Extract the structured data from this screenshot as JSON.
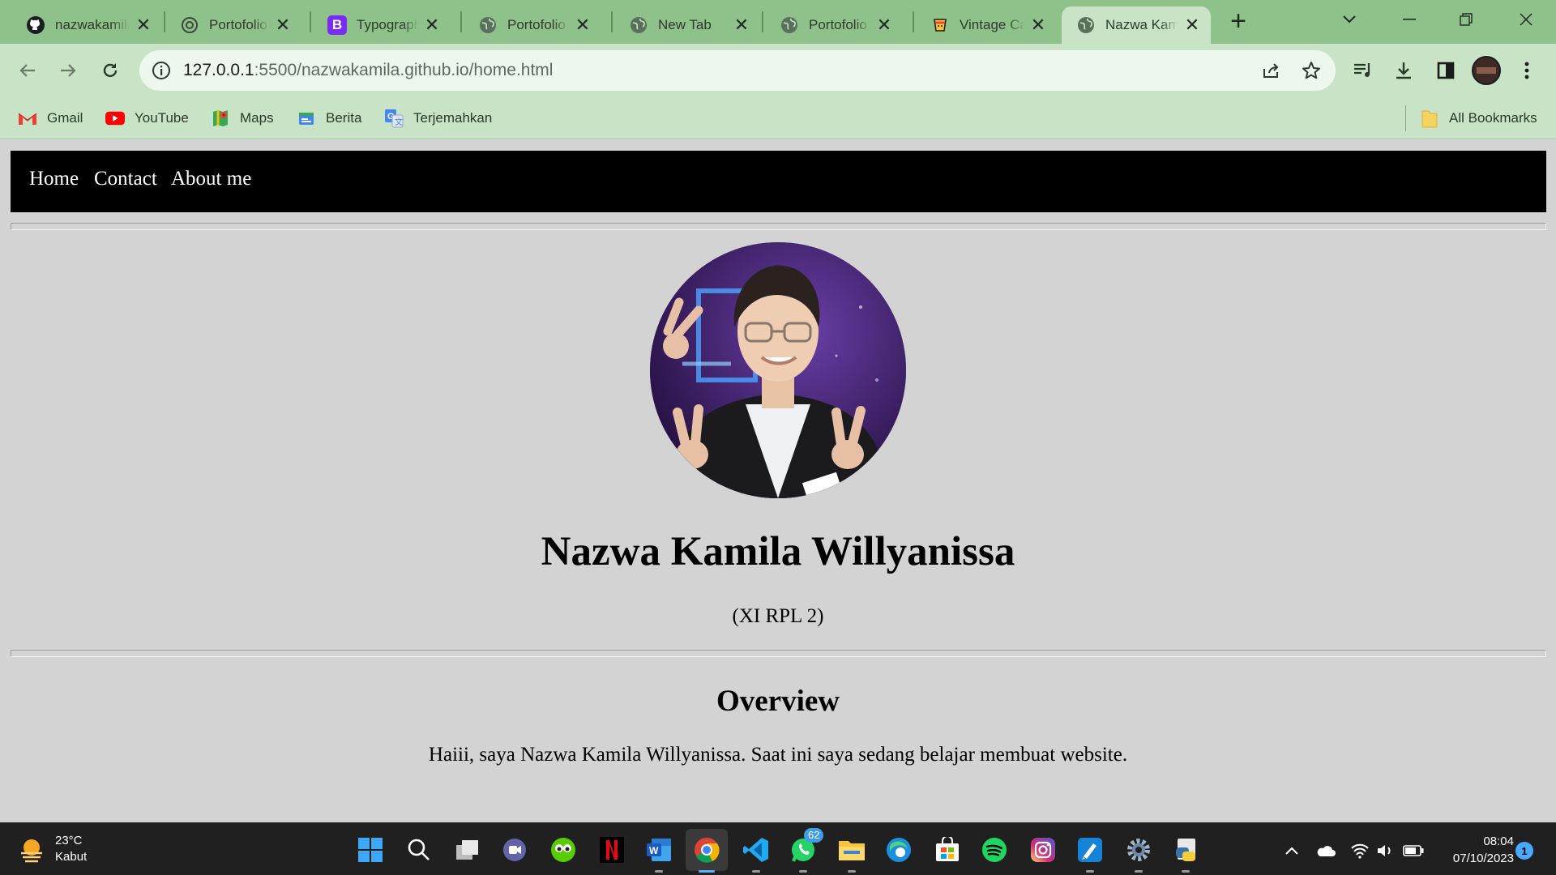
{
  "browser": {
    "tabs": [
      {
        "label": "nazwakamila",
        "icon": "github-icon"
      },
      {
        "label": "Portofolio",
        "icon": "chatgpt-icon"
      },
      {
        "label": "Typography",
        "icon": "bootstrap-icon"
      },
      {
        "label": "Portofolio",
        "icon": "globe-icon"
      },
      {
        "label": "New Tab",
        "icon": "globe-icon"
      },
      {
        "label": "Portofolio",
        "icon": "globe-icon"
      },
      {
        "label": "Vintage Cafe",
        "icon": "cup-icon"
      },
      {
        "label": "Nazwa Kamila",
        "icon": "globe-icon",
        "active": true
      }
    ],
    "close_glyph": "✕",
    "url_host": "127.0.0.1",
    "url_rest": ":5500/nazwakamila.github.io/home.html",
    "bookmarks": [
      {
        "label": "Gmail",
        "icon": "gmail-icon"
      },
      {
        "label": "YouTube",
        "icon": "youtube-icon"
      },
      {
        "label": "Maps",
        "icon": "maps-icon"
      },
      {
        "label": "Berita",
        "icon": "news-icon"
      },
      {
        "label": "Terjemahkan",
        "icon": "translate-icon"
      }
    ],
    "all_bookmarks": "All Bookmarks",
    "colors": {
      "frame": "#8fc18b",
      "toolbar": "#c9e3c6"
    }
  },
  "page": {
    "nav": [
      "Home",
      "Contact",
      "About me"
    ],
    "name": "Nazwa Kamila Willyanissa",
    "class": "(XI RPL 2)",
    "overview_title": "Overview",
    "overview_text": "Haiii, saya Nazwa Kamila Willyanissa. Saat ini saya sedang belajar membuat website.",
    "colors": {
      "background": "#d3d3d3",
      "navbar": "#000000"
    }
  },
  "taskbar": {
    "weather_temp": "23°C",
    "weather_desc": "Kabut",
    "whatsapp_badge": "62",
    "time": "08:04",
    "date": "07/10/2023",
    "notifications": "1"
  }
}
